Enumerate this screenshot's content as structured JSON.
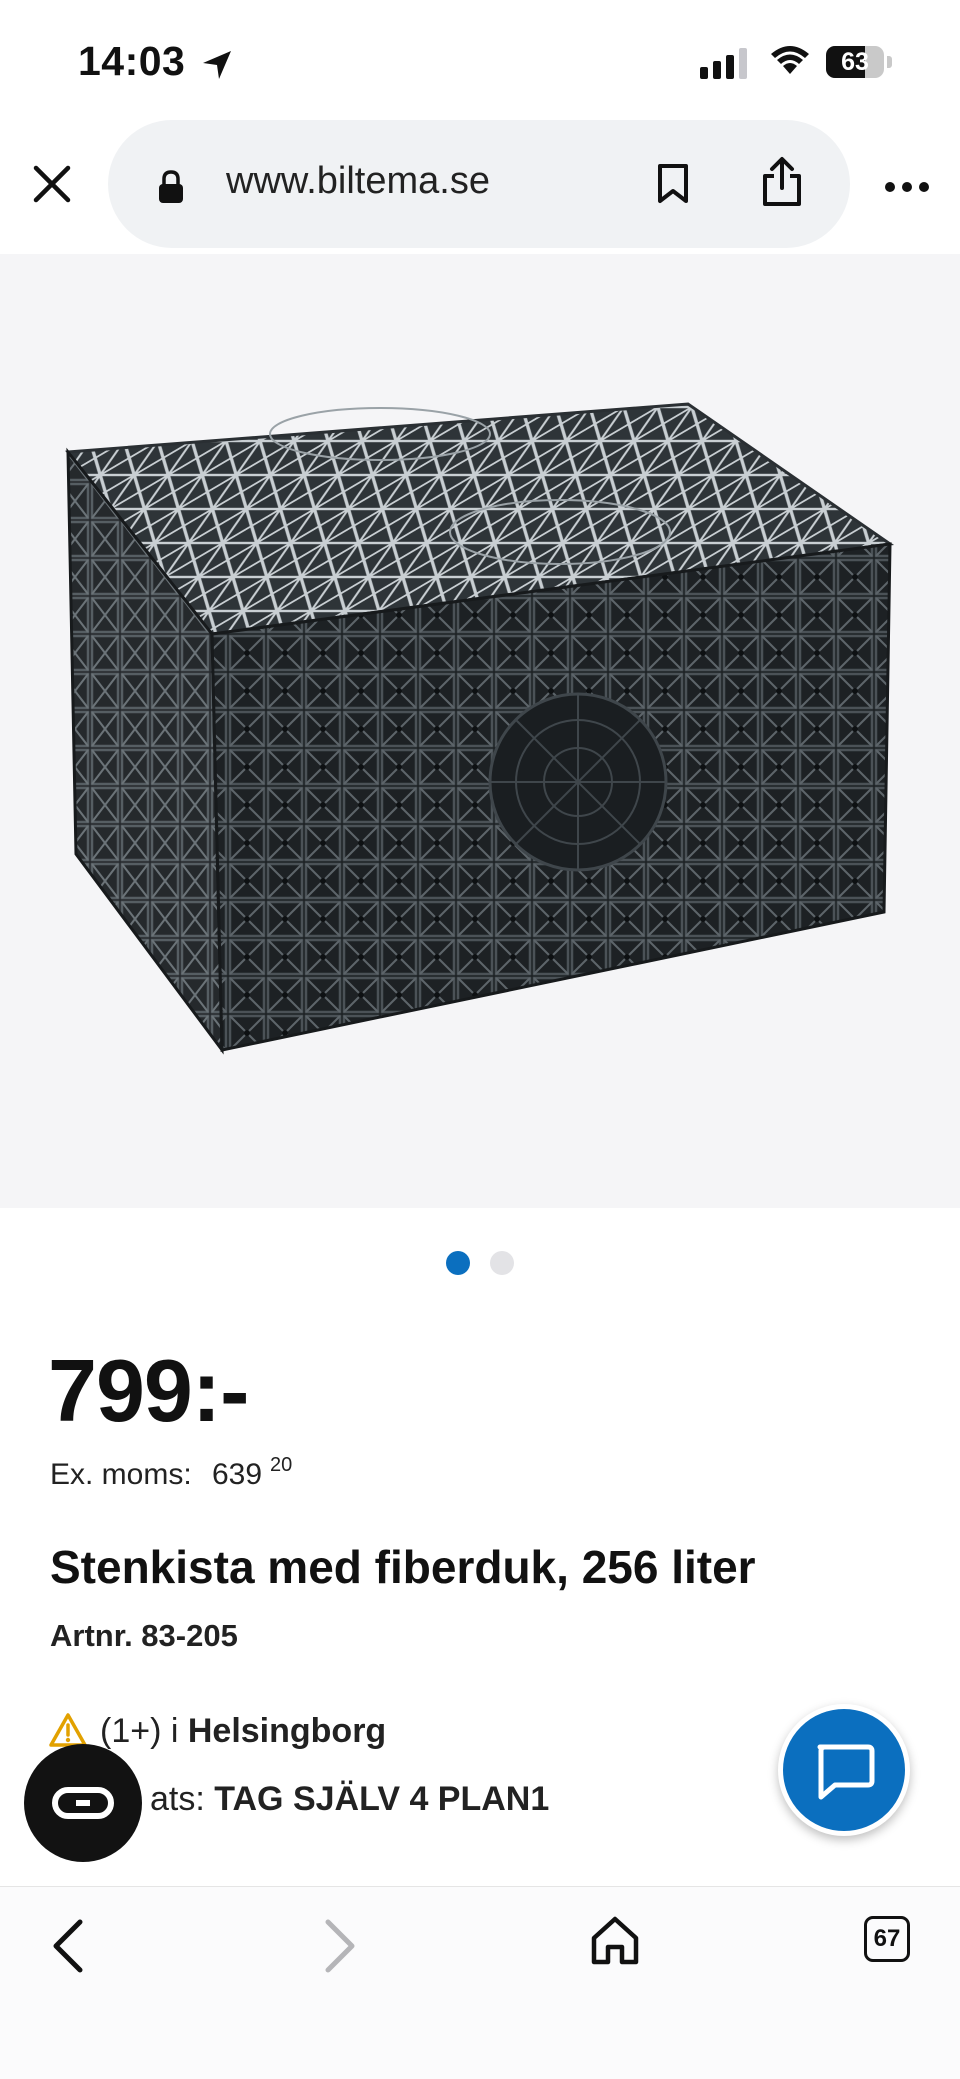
{
  "status_bar": {
    "time": "14:03",
    "battery": "63"
  },
  "browser": {
    "url": "www.biltema.se"
  },
  "product": {
    "image_alt": "Stenkista",
    "pagination": {
      "current": 1,
      "total": 2
    },
    "price": "799:-",
    "ex_moms_label": "Ex. moms:",
    "ex_moms_int": "639",
    "ex_moms_dec": "20",
    "title": "Stenkista med fiberduk, 256 liter",
    "artnr": "Artnr. 83-205",
    "stock_prefix": "(1+) i ",
    "stock_store": "Helsingborg",
    "place_prefix": "ats: ",
    "place_value": "TAG SJÄLV 4 PLAN1"
  },
  "toolbar": {
    "tab_count": "67"
  },
  "colors": {
    "accent": "#0b6fbf",
    "image_bg": "#f5f5f7"
  }
}
